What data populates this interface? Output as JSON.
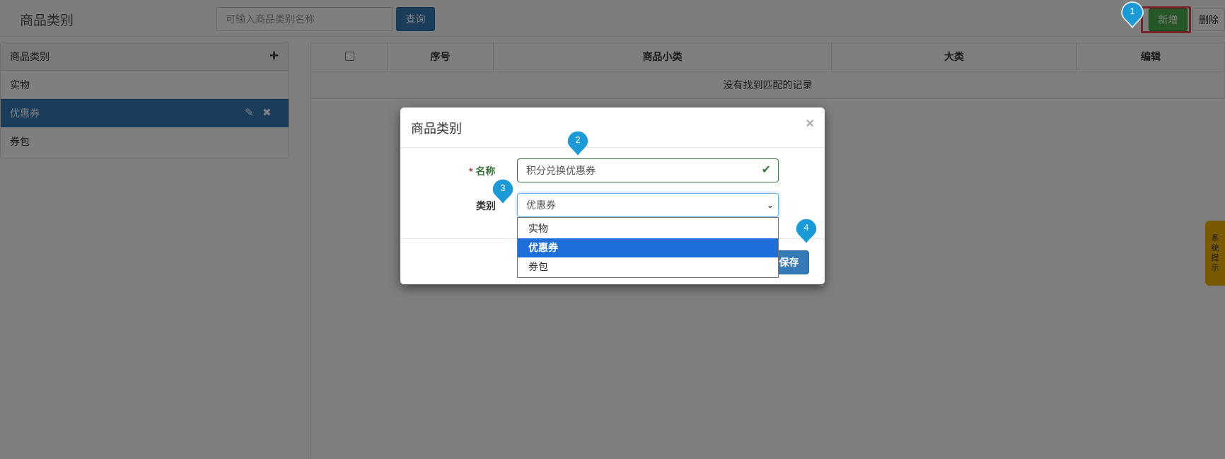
{
  "header": {
    "title": "商品类别",
    "search_placeholder": "可输入商品类别名称",
    "query_label": "查询",
    "add_label": "新增",
    "delete_label": "删除"
  },
  "category_panel": {
    "header": "商品类别",
    "items": [
      {
        "label": "实物"
      },
      {
        "label": "优惠券",
        "active": true
      },
      {
        "label": "券包"
      }
    ]
  },
  "table": {
    "columns": [
      "序号",
      "商品小类",
      "大类",
      "编辑"
    ],
    "empty_text": "没有找到匹配的记录"
  },
  "side_tab": {
    "label": "系统提示"
  },
  "modal": {
    "title": "商品类别",
    "close": "×",
    "name_required_mark": "*",
    "name_label": "名称",
    "name_value": "积分兑换优惠券",
    "category_label": "类别",
    "category_value": "优惠券",
    "options": [
      "实物",
      "优惠券",
      "券包"
    ],
    "selected_option": "优惠券",
    "save_label": "保存"
  },
  "markers": [
    "1",
    "2",
    "3",
    "4"
  ],
  "colors": {
    "primary": "#337ab7",
    "success": "#4cae4c",
    "highlight": "#e8474e",
    "marker": "#1a9bd7",
    "tab": "#f5b400"
  }
}
